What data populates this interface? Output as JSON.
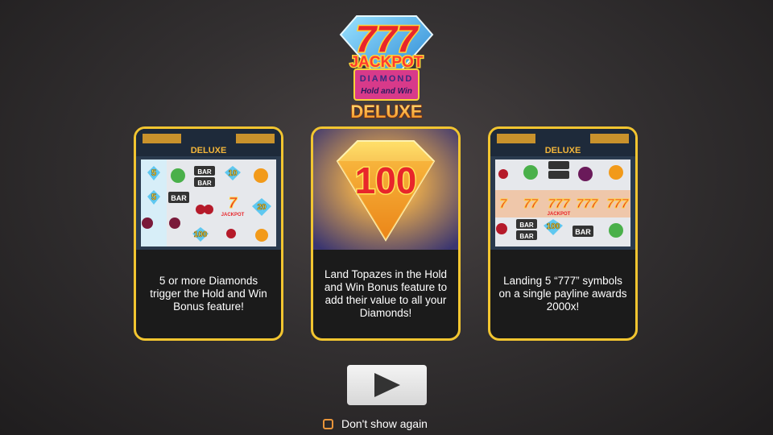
{
  "logo": {
    "line1": "777",
    "line2": "JACKPOT",
    "line3": "DIAMOND",
    "line4": "Hold and Win",
    "line5": "DELUXE"
  },
  "cards": [
    {
      "caption": "5 or more Diamonds trigger the Hold and Win Bonus feature!",
      "reel_values": [
        "5",
        "5",
        "10",
        "20",
        "100"
      ],
      "mini_logo": "DELUXE"
    },
    {
      "caption": "Land Topazes in the Hold and Win Bonus feature to add their value to all your Diamonds!",
      "gem_value": "100"
    },
    {
      "caption": "Landing 5 “777” symbols on a single payline awards 2000x!",
      "reel_values": [
        "100"
      ],
      "mini_logo": "DELUXE"
    }
  ],
  "reel_labels": {
    "bar": "BAR",
    "jackpot": "JACKPOT"
  },
  "play_button": {
    "icon": "play-icon"
  },
  "dont_show": {
    "label": "Don't show again",
    "checked": false
  },
  "colors": {
    "accent": "#f2c530",
    "checkbox": "#e8953a",
    "button": "#e6e6e6"
  }
}
